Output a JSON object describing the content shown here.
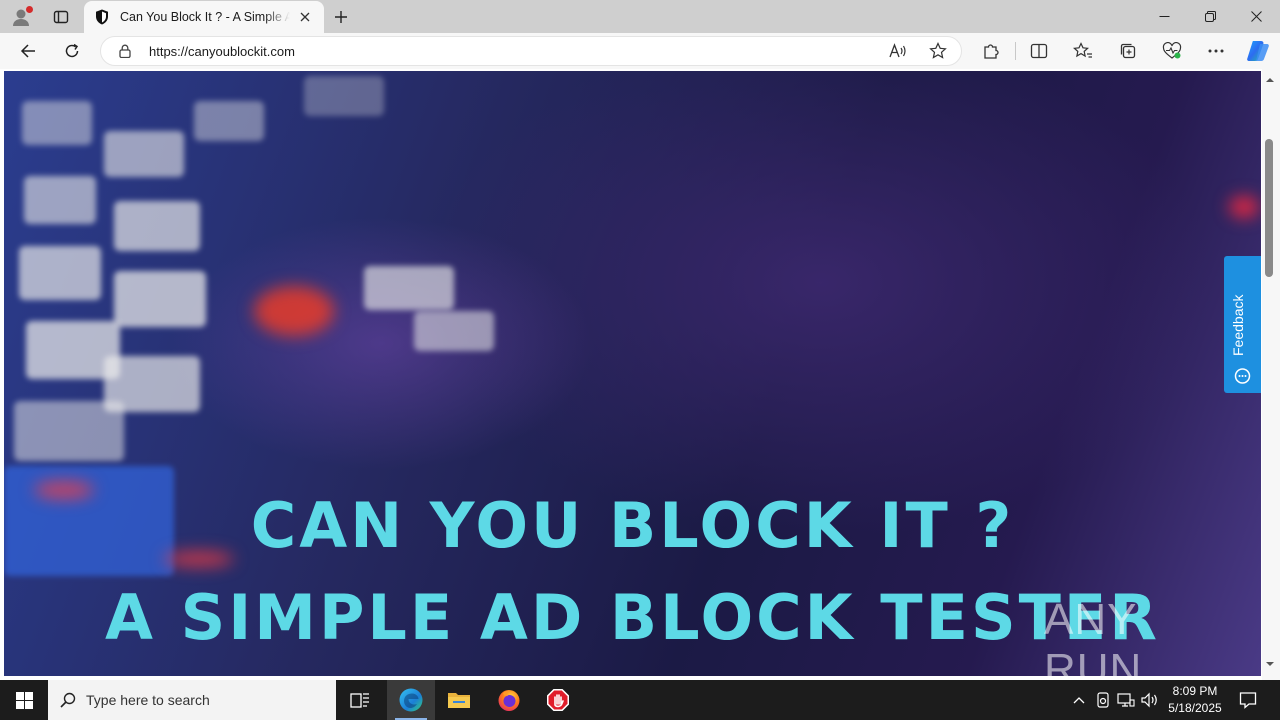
{
  "browser": {
    "tab": {
      "title": "Can You Block It ? - A Simple Ad Block Tester"
    },
    "address": {
      "url": "https://canyoublockit.com"
    }
  },
  "page": {
    "headline_line1": "CAN YOU BLOCK IT ?",
    "headline_line2": "A SIMPLE AD BLOCK TESTER",
    "feedback_label": "Feedback",
    "watermark": "ANY RUN"
  },
  "taskbar": {
    "search_placeholder": "Type here to search",
    "time": "8:09 PM",
    "date": "5/18/2025"
  },
  "colors": {
    "headline": "#5dd9e6",
    "feedback_bg": "#1e90e0",
    "taskbar_bg": "#1c1c1c",
    "titlebar_bg": "#cfcfcf"
  }
}
